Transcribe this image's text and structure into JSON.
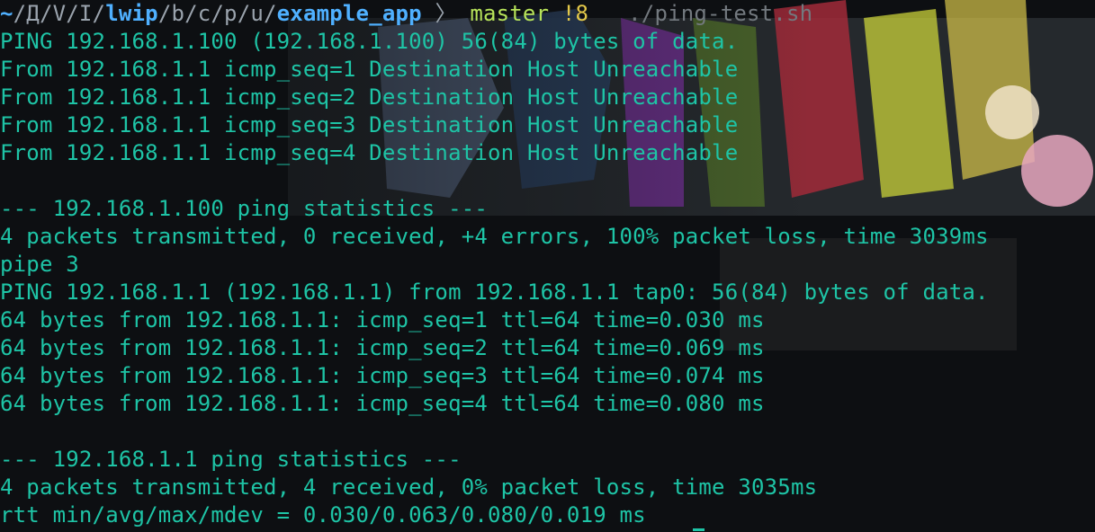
{
  "prompt": {
    "home": "~",
    "path_dim_1": "/Д/V/I/",
    "path_bold_1": "lwip",
    "path_dim_2": "/b/c/p/u/",
    "path_bold_2": "example_app",
    "separator": "〉",
    "branch": "master",
    "dirty": "!8",
    "command": "./ping-test.sh"
  },
  "output": [
    "PING 192.168.1.100 (192.168.1.100) 56(84) bytes of data.",
    "From 192.168.1.1 icmp_seq=1 Destination Host Unreachable",
    "From 192.168.1.1 icmp_seq=2 Destination Host Unreachable",
    "From 192.168.1.1 icmp_seq=3 Destination Host Unreachable",
    "From 192.168.1.1 icmp_seq=4 Destination Host Unreachable",
    "",
    "--- 192.168.1.100 ping statistics ---",
    "4 packets transmitted, 0 received, +4 errors, 100% packet loss, time 3039ms",
    "pipe 3",
    "PING 192.168.1.1 (192.168.1.1) from 192.168.1.1 tap0: 56(84) bytes of data.",
    "64 bytes from 192.168.1.1: icmp_seq=1 ttl=64 time=0.030 ms",
    "64 bytes from 192.168.1.1: icmp_seq=2 ttl=64 time=0.069 ms",
    "64 bytes from 192.168.1.1: icmp_seq=3 ttl=64 time=0.074 ms",
    "64 bytes from 192.168.1.1: icmp_seq=4 ttl=64 time=0.080 ms",
    "",
    "--- 192.168.1.1 ping statistics ---",
    "4 packets transmitted, 4 received, 0% packet loss, time 3035ms",
    "rtt min/avg/max/mdev = 0.030/0.063/0.080/0.019 ms"
  ],
  "colors": {
    "output_text": "#1ec4a6",
    "path_bold": "#4fb0ff",
    "branch": "#b7e35a",
    "dirty": "#e3c84a",
    "command": "#73797f",
    "background": "#0d0f12"
  }
}
